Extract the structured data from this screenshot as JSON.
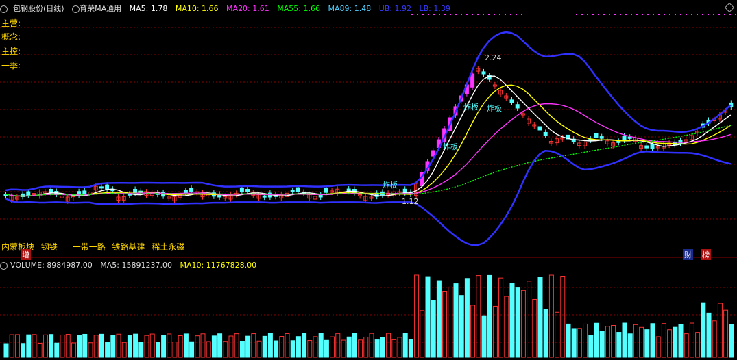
{
  "header": {
    "stock": "包钢股份(日线)",
    "indicator": "育荣MA通用",
    "ma5": "MA5: 1.78",
    "ma10": "MA10: 1.66",
    "ma20": "MA20: 1.61",
    "ma55": "MA55: 1.66",
    "ma89": "MA89: 1.48",
    "ub": "UB: 1.92",
    "lb": "LB: 1.39"
  },
  "side_labels": [
    "主营:",
    "概念:",
    "主控:",
    "一季:"
  ],
  "sectors": [
    "内蒙板块",
    "钢铁",
    "一带一路",
    "铁路基建",
    "稀土永磁"
  ],
  "tags": {
    "zha1": "炸板",
    "zha2": "炸板",
    "zha3": "炸板",
    "zha4": "炸板",
    "high": "2.24",
    "low": "1.12",
    "zeng": "增",
    "cai": "财",
    "bang": "榜"
  },
  "volume_header": {
    "volume": "VOLUME: 8984987.00",
    "ma5": "MA5: 15891237.00",
    "ma10": "MA10: 11767828.00"
  },
  "colors": {
    "up": "#ff3333",
    "down": "#54ffff",
    "limit_up": "#ff33ff",
    "ma5": "#ffffff",
    "ma10": "#ffff00",
    "ma20": "#ff33ff",
    "ma55": "#00ff00",
    "boll": "#3030ff",
    "grid": "#8b0000"
  }
}
